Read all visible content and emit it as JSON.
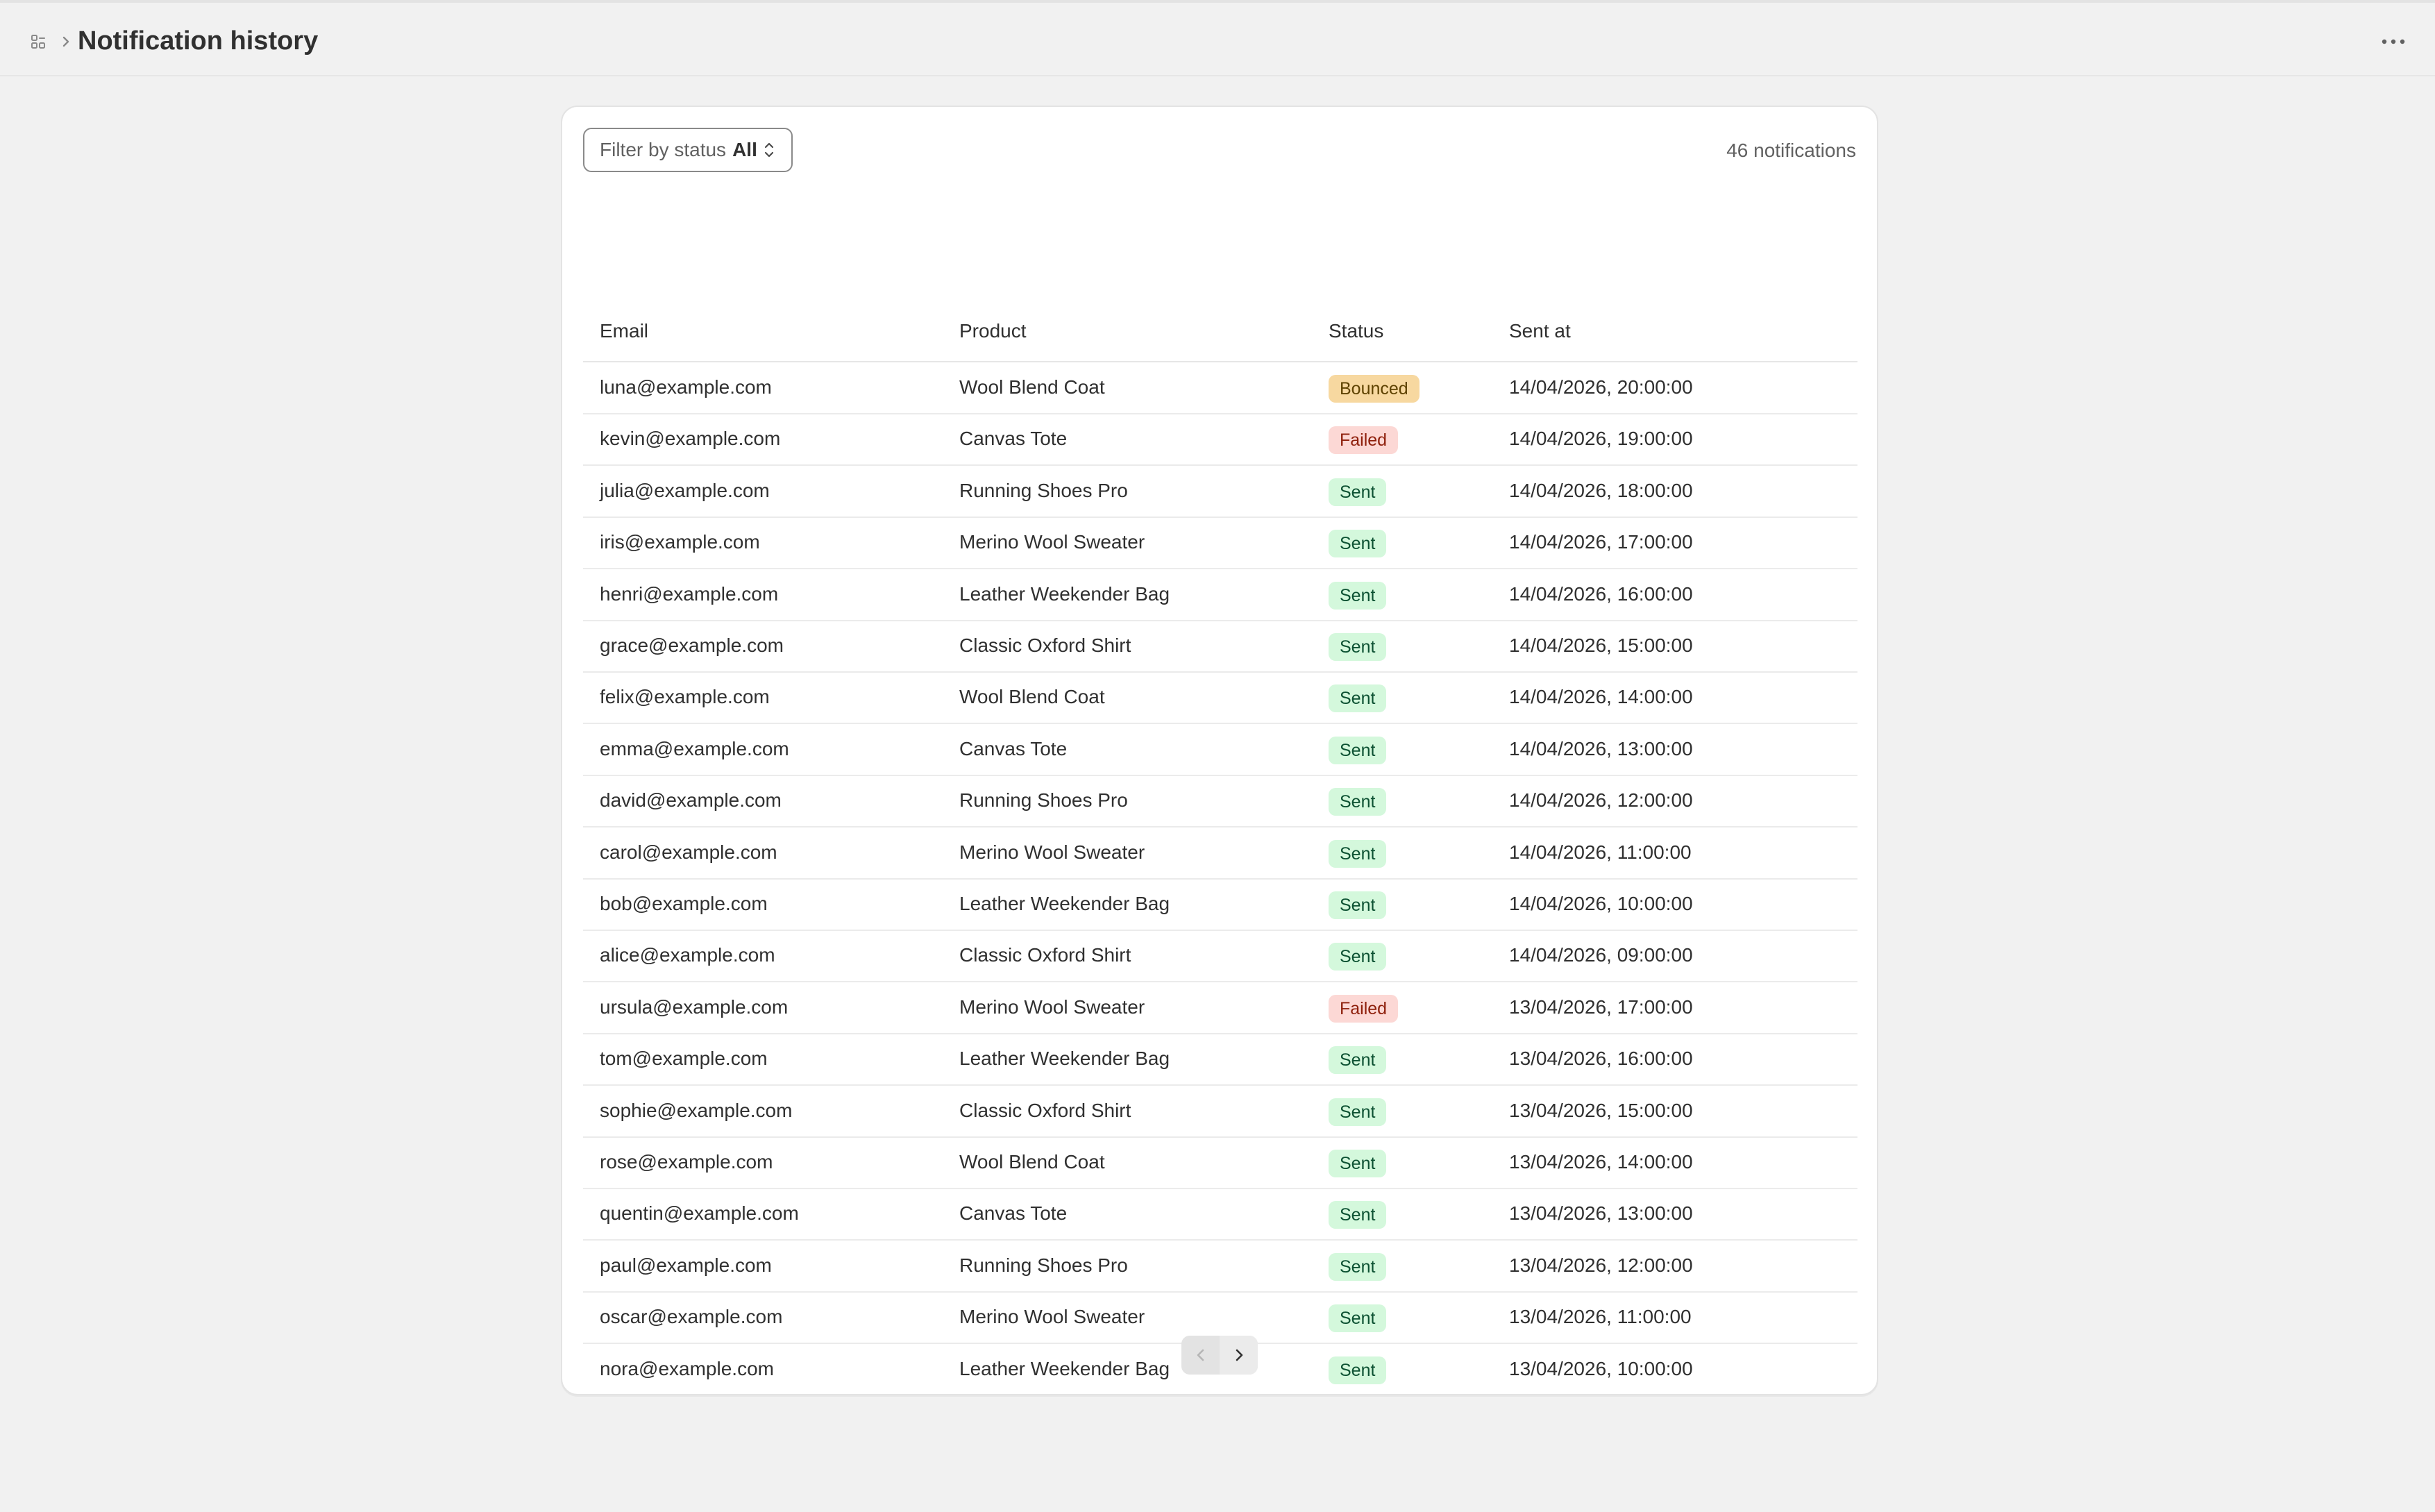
{
  "header": {
    "title": "Notification history",
    "app_icon": "apps-grid-icon",
    "breadcrumb_separator_icon": "chevron-right-icon",
    "more_icon": "more-horizontal-icon"
  },
  "filter": {
    "label": "Filter by status",
    "value": "All",
    "icon": "select-caret-icon"
  },
  "count_text": "46 notifications",
  "table": {
    "columns": [
      "Email",
      "Product",
      "Status",
      "Sent at"
    ],
    "rows": [
      {
        "email": "luna@example.com",
        "product": "Wool Blend Coat",
        "status": "Bounced",
        "sent_at": "14/04/2026, 20:00:00"
      },
      {
        "email": "kevin@example.com",
        "product": "Canvas Tote",
        "status": "Failed",
        "sent_at": "14/04/2026, 19:00:00"
      },
      {
        "email": "julia@example.com",
        "product": "Running Shoes Pro",
        "status": "Sent",
        "sent_at": "14/04/2026, 18:00:00"
      },
      {
        "email": "iris@example.com",
        "product": "Merino Wool Sweater",
        "status": "Sent",
        "sent_at": "14/04/2026, 17:00:00"
      },
      {
        "email": "henri@example.com",
        "product": "Leather Weekender Bag",
        "status": "Sent",
        "sent_at": "14/04/2026, 16:00:00"
      },
      {
        "email": "grace@example.com",
        "product": "Classic Oxford Shirt",
        "status": "Sent",
        "sent_at": "14/04/2026, 15:00:00"
      },
      {
        "email": "felix@example.com",
        "product": "Wool Blend Coat",
        "status": "Sent",
        "sent_at": "14/04/2026, 14:00:00"
      },
      {
        "email": "emma@example.com",
        "product": "Canvas Tote",
        "status": "Sent",
        "sent_at": "14/04/2026, 13:00:00"
      },
      {
        "email": "david@example.com",
        "product": "Running Shoes Pro",
        "status": "Sent",
        "sent_at": "14/04/2026, 12:00:00"
      },
      {
        "email": "carol@example.com",
        "product": "Merino Wool Sweater",
        "status": "Sent",
        "sent_at": "14/04/2026, 11:00:00"
      },
      {
        "email": "bob@example.com",
        "product": "Leather Weekender Bag",
        "status": "Sent",
        "sent_at": "14/04/2026, 10:00:00"
      },
      {
        "email": "alice@example.com",
        "product": "Classic Oxford Shirt",
        "status": "Sent",
        "sent_at": "14/04/2026, 09:00:00"
      },
      {
        "email": "ursula@example.com",
        "product": "Merino Wool Sweater",
        "status": "Failed",
        "sent_at": "13/04/2026, 17:00:00"
      },
      {
        "email": "tom@example.com",
        "product": "Leather Weekender Bag",
        "status": "Sent",
        "sent_at": "13/04/2026, 16:00:00"
      },
      {
        "email": "sophie@example.com",
        "product": "Classic Oxford Shirt",
        "status": "Sent",
        "sent_at": "13/04/2026, 15:00:00"
      },
      {
        "email": "rose@example.com",
        "product": "Wool Blend Coat",
        "status": "Sent",
        "sent_at": "13/04/2026, 14:00:00"
      },
      {
        "email": "quentin@example.com",
        "product": "Canvas Tote",
        "status": "Sent",
        "sent_at": "13/04/2026, 13:00:00"
      },
      {
        "email": "paul@example.com",
        "product": "Running Shoes Pro",
        "status": "Sent",
        "sent_at": "13/04/2026, 12:00:00"
      },
      {
        "email": "oscar@example.com",
        "product": "Merino Wool Sweater",
        "status": "Sent",
        "sent_at": "13/04/2026, 11:00:00"
      },
      {
        "email": "nora@example.com",
        "product": "Leather Weekender Bag",
        "status": "Sent",
        "sent_at": "13/04/2026, 10:00:00"
      }
    ]
  },
  "status_colors": {
    "Sent": {
      "bg": "#d4f8dc",
      "fg": "#0c5132"
    },
    "Failed": {
      "bg": "#fcd8d5",
      "fg": "#8e1f0b"
    },
    "Bounced": {
      "bg": "#f7d8a0",
      "fg": "#5e4200"
    }
  },
  "pagination": {
    "prev_icon": "chevron-left-icon",
    "next_icon": "chevron-right-icon",
    "prev_enabled": false,
    "next_enabled": true
  }
}
